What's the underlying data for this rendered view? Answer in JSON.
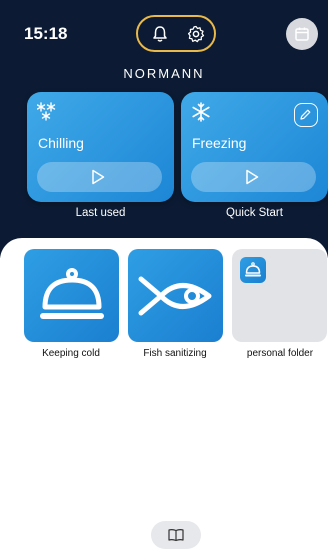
{
  "status_bar": {
    "time": "15:18"
  },
  "header": {
    "brand": "NORMANN",
    "icons": [
      "bell-icon",
      "gear-icon",
      "calendar-icon"
    ]
  },
  "cards": [
    {
      "title": "Chilling",
      "caption": "Last used",
      "icon": "double-snowflake-icon"
    },
    {
      "title": "Freezing",
      "caption": "Quick Start",
      "icon": "snowflake-icon"
    }
  ],
  "tiles": [
    {
      "label": "Keeping cold",
      "icon": "cloche-icon"
    },
    {
      "label": "Fish sanitizing",
      "icon": "fish-icon"
    },
    {
      "label": "personal folder",
      "icon": "cloche-icon"
    }
  ],
  "footer": {
    "icon": "book-icon"
  },
  "colors": {
    "header_bg": "#0c1b33",
    "accent_blue": "#1d86d6",
    "pill_border": "#e9b949"
  }
}
